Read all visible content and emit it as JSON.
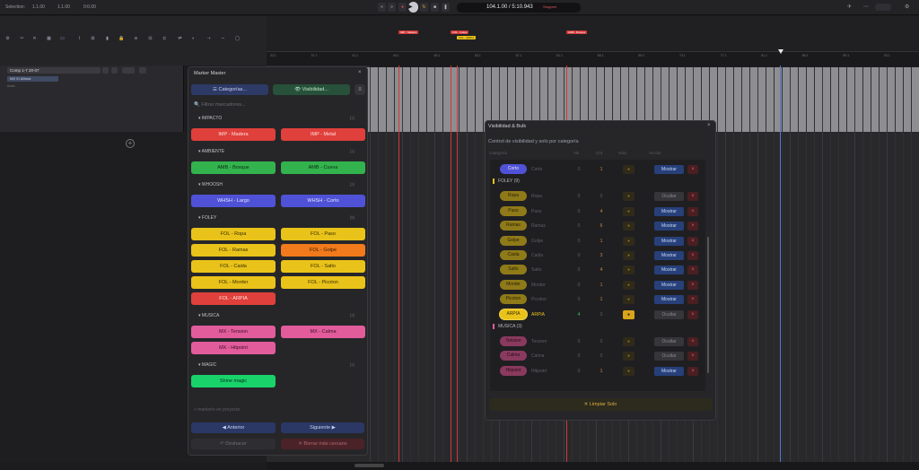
{
  "topbar": {
    "selection_label": "Selection:",
    "sel_start": "1.1.00",
    "sel_end": "1.1.00",
    "sel_len": "0:0.00",
    "transport_icons": [
      "rewind-icon",
      "fast-forward-icon",
      "record-icon",
      "play-icon",
      "loop-icon",
      "stop-icon",
      "pause-icon"
    ],
    "time": "104.1.00 / 5:10.943",
    "status": "Stopped",
    "right_icons": [
      "pin-icon",
      "link-icon",
      "cloud-icon",
      "settings-icon"
    ]
  },
  "ruler": {
    "labels": [
      "33.1",
      "37.1",
      "41.1",
      "45.1",
      "49.1",
      "53.1",
      "57.1",
      "61.1",
      "65.1",
      "69.1",
      "73.1",
      "77.1",
      "81.1",
      "85.1",
      "89.1",
      "93.1",
      "97.1"
    ],
    "flags": [
      "IMP - Madera",
      "FOL - Golpe",
      "FOL - ARPIA",
      "AMB - Bosque"
    ]
  },
  "track": {
    "name": "Comp 1-7 20-07",
    "clip": "MIX 01 Alitrack",
    "sub": "Audio"
  },
  "marker_master": {
    "title": "Marker Master",
    "categories_btn": "☰ Categorías...",
    "visibility_btn": "👁 Visibilidad...",
    "menu_btn": "≡",
    "search_placeholder": "🔍 Filtrar marcadores...",
    "sections": [
      {
        "name": "IMPACTO",
        "count": "[1]",
        "markers": [
          {
            "label": "IMP - Madera",
            "color": "#e0403b",
            "text": "#ffe0de"
          },
          {
            "label": "IMP - Metal",
            "color": "#e0403b",
            "text": "#ffe0de"
          }
        ]
      },
      {
        "name": "AMBIENTE",
        "count": "[1]",
        "markers": [
          {
            "label": "AMB - Bosque",
            "color": "#33b34d",
            "text": "#0d2a14"
          },
          {
            "label": "AMB - Cueva",
            "color": "#33b34d",
            "text": "#0d2a14"
          }
        ]
      },
      {
        "name": "WHOOSH",
        "count": "[2]",
        "markers": [
          {
            "label": "WHSH - Largo",
            "color": "#4f52d6",
            "text": "#e3e4ff"
          },
          {
            "label": "WHSH - Corto",
            "color": "#4f52d6",
            "text": "#e3e4ff"
          }
        ]
      },
      {
        "name": "FOLEY",
        "count": "[9]",
        "markers": [
          {
            "label": "FOL - Ropa",
            "color": "#e9c31a",
            "text": "#3a2e00"
          },
          {
            "label": "FOL - Paso",
            "color": "#e9c31a",
            "text": "#3a2e00"
          },
          {
            "label": "FOL - Ramas",
            "color": "#e9c31a",
            "text": "#3a2e00"
          },
          {
            "label": "FOL - Golpe",
            "color": "#f07a1c",
            "text": "#3a1a00"
          },
          {
            "label": "FOL - Caida",
            "color": "#e9c31a",
            "text": "#3a2e00"
          },
          {
            "label": "FOL - Salto",
            "color": "#e9c31a",
            "text": "#3a2e00"
          },
          {
            "label": "FOL - Morder",
            "color": "#e9c31a",
            "text": "#3a2e00"
          },
          {
            "label": "FOL - Picoton",
            "color": "#e9c31a",
            "text": "#3a2e00"
          },
          {
            "label": "FOL - ARPIA",
            "color": "#e0403b",
            "text": "#ffe0de"
          }
        ]
      },
      {
        "name": "MUSICA",
        "count": "[3]",
        "markers": [
          {
            "label": "MX - Tension",
            "color": "#e25c9c",
            "text": "#3a0f22"
          },
          {
            "label": "MX - Calma",
            "color": "#e25c9c",
            "text": "#3a0f22"
          },
          {
            "label": "MX - Hitpoint",
            "color": "#e25c9c",
            "text": "#3a0f22"
          }
        ]
      },
      {
        "name": "MAGIC",
        "count": "[1]",
        "markers": [
          {
            "label": "Shine magic",
            "color": "#19d36a",
            "text": "#06301a"
          }
        ]
      }
    ],
    "footer_note": "+ marker/s en proyecto",
    "prev_btn": "◀ Anterior",
    "next_btn": "Siguiente ▶",
    "undo_btn": "↶ Deshacer",
    "delete_btn": "✕ Borrar más cercano"
  },
  "visibility": {
    "title": "Visibilidad & Bulk",
    "close": "×",
    "subtitle": "Control de visibilidad y solo por categoría",
    "headers": {
      "cat": "Categoría",
      "vis": "Vis",
      "cnt": "Cnt",
      "solo": "Solo",
      "acc": "Acción"
    },
    "rows": [
      {
        "kind": "item",
        "pill": "Corto",
        "name": "Corto",
        "color": "#4f52d6",
        "ptext": "#e3e4ff",
        "vis": "0",
        "cnt": "1",
        "action": "Mostrar",
        "solo_on": false
      },
      {
        "kind": "group",
        "label": "FOLEY (9)",
        "color": "#e9c31a"
      },
      {
        "kind": "item",
        "pill": "Ropa",
        "name": "Ropa",
        "color": "#8f7a19",
        "ptext": "#2a2200",
        "vis": "0",
        "cnt": "0",
        "action": "Ocultar",
        "solo_on": false
      },
      {
        "kind": "item",
        "pill": "Paso",
        "name": "Paso",
        "color": "#8f7a19",
        "ptext": "#2a2200",
        "vis": "0",
        "cnt": "4",
        "action": "Mostrar",
        "solo_on": false
      },
      {
        "kind": "item",
        "pill": "Ramas",
        "name": "Ramas",
        "color": "#8f7a19",
        "ptext": "#2a2200",
        "vis": "0",
        "cnt": "6",
        "action": "Mostrar",
        "solo_on": false
      },
      {
        "kind": "item",
        "pill": "Golpe",
        "name": "Golpe",
        "color": "#8f7a19",
        "ptext": "#2a2200",
        "vis": "0",
        "cnt": "1",
        "action": "Mostrar",
        "solo_on": false
      },
      {
        "kind": "item",
        "pill": "Caida",
        "name": "Caida",
        "color": "#8f7a19",
        "ptext": "#2a2200",
        "vis": "0",
        "cnt": "3",
        "action": "Mostrar",
        "solo_on": false
      },
      {
        "kind": "item",
        "pill": "Salto",
        "name": "Salto",
        "color": "#8f7a19",
        "ptext": "#2a2200",
        "vis": "0",
        "cnt": "4",
        "action": "Mostrar",
        "solo_on": false
      },
      {
        "kind": "item",
        "pill": "Morder",
        "name": "Morder",
        "color": "#8f7a19",
        "ptext": "#2a2200",
        "vis": "0",
        "cnt": "1",
        "action": "Mostrar",
        "solo_on": false
      },
      {
        "kind": "item",
        "pill": "Picoton",
        "name": "Picoton",
        "color": "#8f7a19",
        "ptext": "#2a2200",
        "vis": "0",
        "cnt": "1",
        "action": "Mostrar",
        "solo_on": false
      },
      {
        "kind": "item",
        "pill": "ARPIA",
        "name": "ARPIA",
        "color": "#e9c31a",
        "ptext": "#3a2e00",
        "vis": "4",
        "cnt": "0",
        "action": "Ocultar",
        "solo_on": true,
        "active": true
      },
      {
        "kind": "group",
        "label": "MUSICA (3)",
        "color": "#e25c9c"
      },
      {
        "kind": "item",
        "pill": "Tension",
        "name": "Tension",
        "color": "#8a3a5e",
        "ptext": "#2a0b18",
        "vis": "0",
        "cnt": "0",
        "action": "Ocultar",
        "solo_on": false
      },
      {
        "kind": "item",
        "pill": "Calma",
        "name": "Calma",
        "color": "#8a3a5e",
        "ptext": "#2a0b18",
        "vis": "0",
        "cnt": "0",
        "action": "Ocultar",
        "solo_on": false
      },
      {
        "kind": "item",
        "pill": "Hitpoint",
        "name": "Hitpoint",
        "color": "#8a3a5e",
        "ptext": "#2a0b18",
        "vis": "0",
        "cnt": "1",
        "action": "Mostrar",
        "solo_on": false
      }
    ],
    "clear_btn": "✕ Limpiar Solo"
  }
}
